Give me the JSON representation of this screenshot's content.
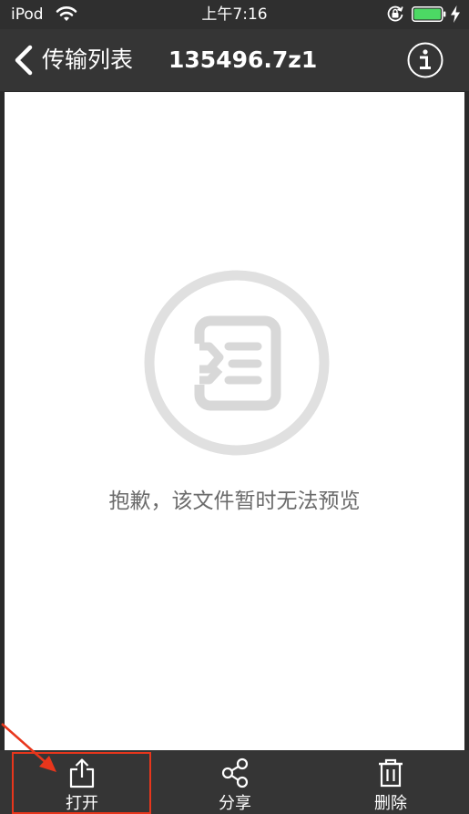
{
  "status_bar": {
    "carrier": "iPod",
    "time": "上午7:16",
    "wifi_icon": "wifi-icon",
    "rotation_lock_icon": "rotation-lock-icon",
    "battery_icon": "battery-icon",
    "charging_icon": "charging-bolt-icon",
    "battery_color": "#4cd964"
  },
  "nav_bar": {
    "back_label": "传输列表",
    "back_icon": "chevron-left-icon",
    "title": "135496.7z1",
    "info_icon": "info-icon"
  },
  "main": {
    "placeholder_icon": "document-unavailable-icon",
    "message": "抱歉，该文件暂时无法预览"
  },
  "toolbar": {
    "open_label": "打开",
    "open_icon": "share-export-icon",
    "share_label": "分享",
    "share_icon": "share-nodes-icon",
    "delete_label": "删除",
    "delete_icon": "trash-icon"
  },
  "annotation": {
    "highlight_color": "#e8361c"
  }
}
